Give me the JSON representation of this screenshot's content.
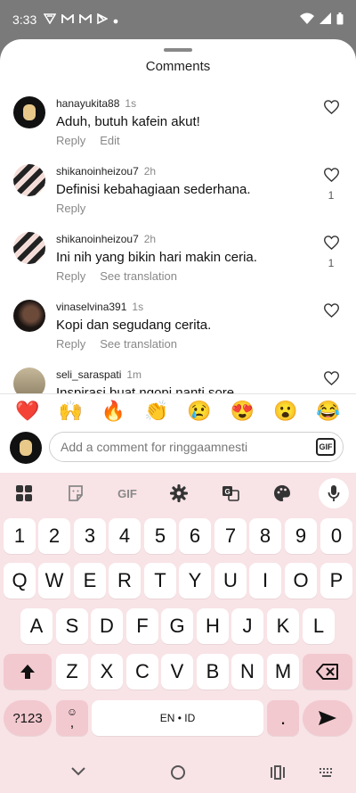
{
  "status_bar": {
    "time": "3:33"
  },
  "sheet": {
    "title": "Comments"
  },
  "comments": [
    {
      "user": "hanayukita88",
      "age": "1s",
      "text": "Aduh, butuh kafein akut!",
      "actions": [
        "Reply",
        "Edit"
      ],
      "likes": ""
    },
    {
      "user": "shikanoinheizou7",
      "age": "2h",
      "text": "Definisi kebahagiaan sederhana.",
      "actions": [
        "Reply"
      ],
      "likes": "1"
    },
    {
      "user": "shikanoinheizou7",
      "age": "2h",
      "text": "Ini nih yang bikin hari makin ceria.",
      "actions": [
        "Reply",
        "See translation"
      ],
      "likes": "1"
    },
    {
      "user": "vinaselvina391",
      "age": "1s",
      "text": "Kopi dan segudang cerita.",
      "actions": [
        "Reply",
        "See translation"
      ],
      "likes": ""
    },
    {
      "user": "seli_saraspati",
      "age": "1m",
      "text": "Inspirasi buat ngopi nanti sore.",
      "actions": [],
      "likes": ""
    }
  ],
  "emojis": [
    "❤️",
    "🙌",
    "🔥",
    "👏",
    "😢",
    "😍",
    "😮",
    "😂"
  ],
  "comment_input": {
    "placeholder": "Add a comment for ringgaamnesti",
    "gif_label": "GIF"
  },
  "keyboard": {
    "toolbar_gif": "GIF",
    "row_numbers": [
      "1",
      "2",
      "3",
      "4",
      "5",
      "6",
      "7",
      "8",
      "9",
      "0"
    ],
    "row_q": [
      "Q",
      "W",
      "E",
      "R",
      "T",
      "Y",
      "U",
      "I",
      "O",
      "P"
    ],
    "row_a": [
      "A",
      "S",
      "D",
      "F",
      "G",
      "H",
      "J",
      "K",
      "L"
    ],
    "row_z": [
      "Z",
      "X",
      "C",
      "V",
      "B",
      "N",
      "M"
    ],
    "symbols_label": "?123",
    "comma_label": ",",
    "space_label": "EN • ID",
    "period_label": "."
  },
  "colors": {
    "keyboard_bg": "#f8e3e6",
    "special_key": "#f2c9cf"
  }
}
